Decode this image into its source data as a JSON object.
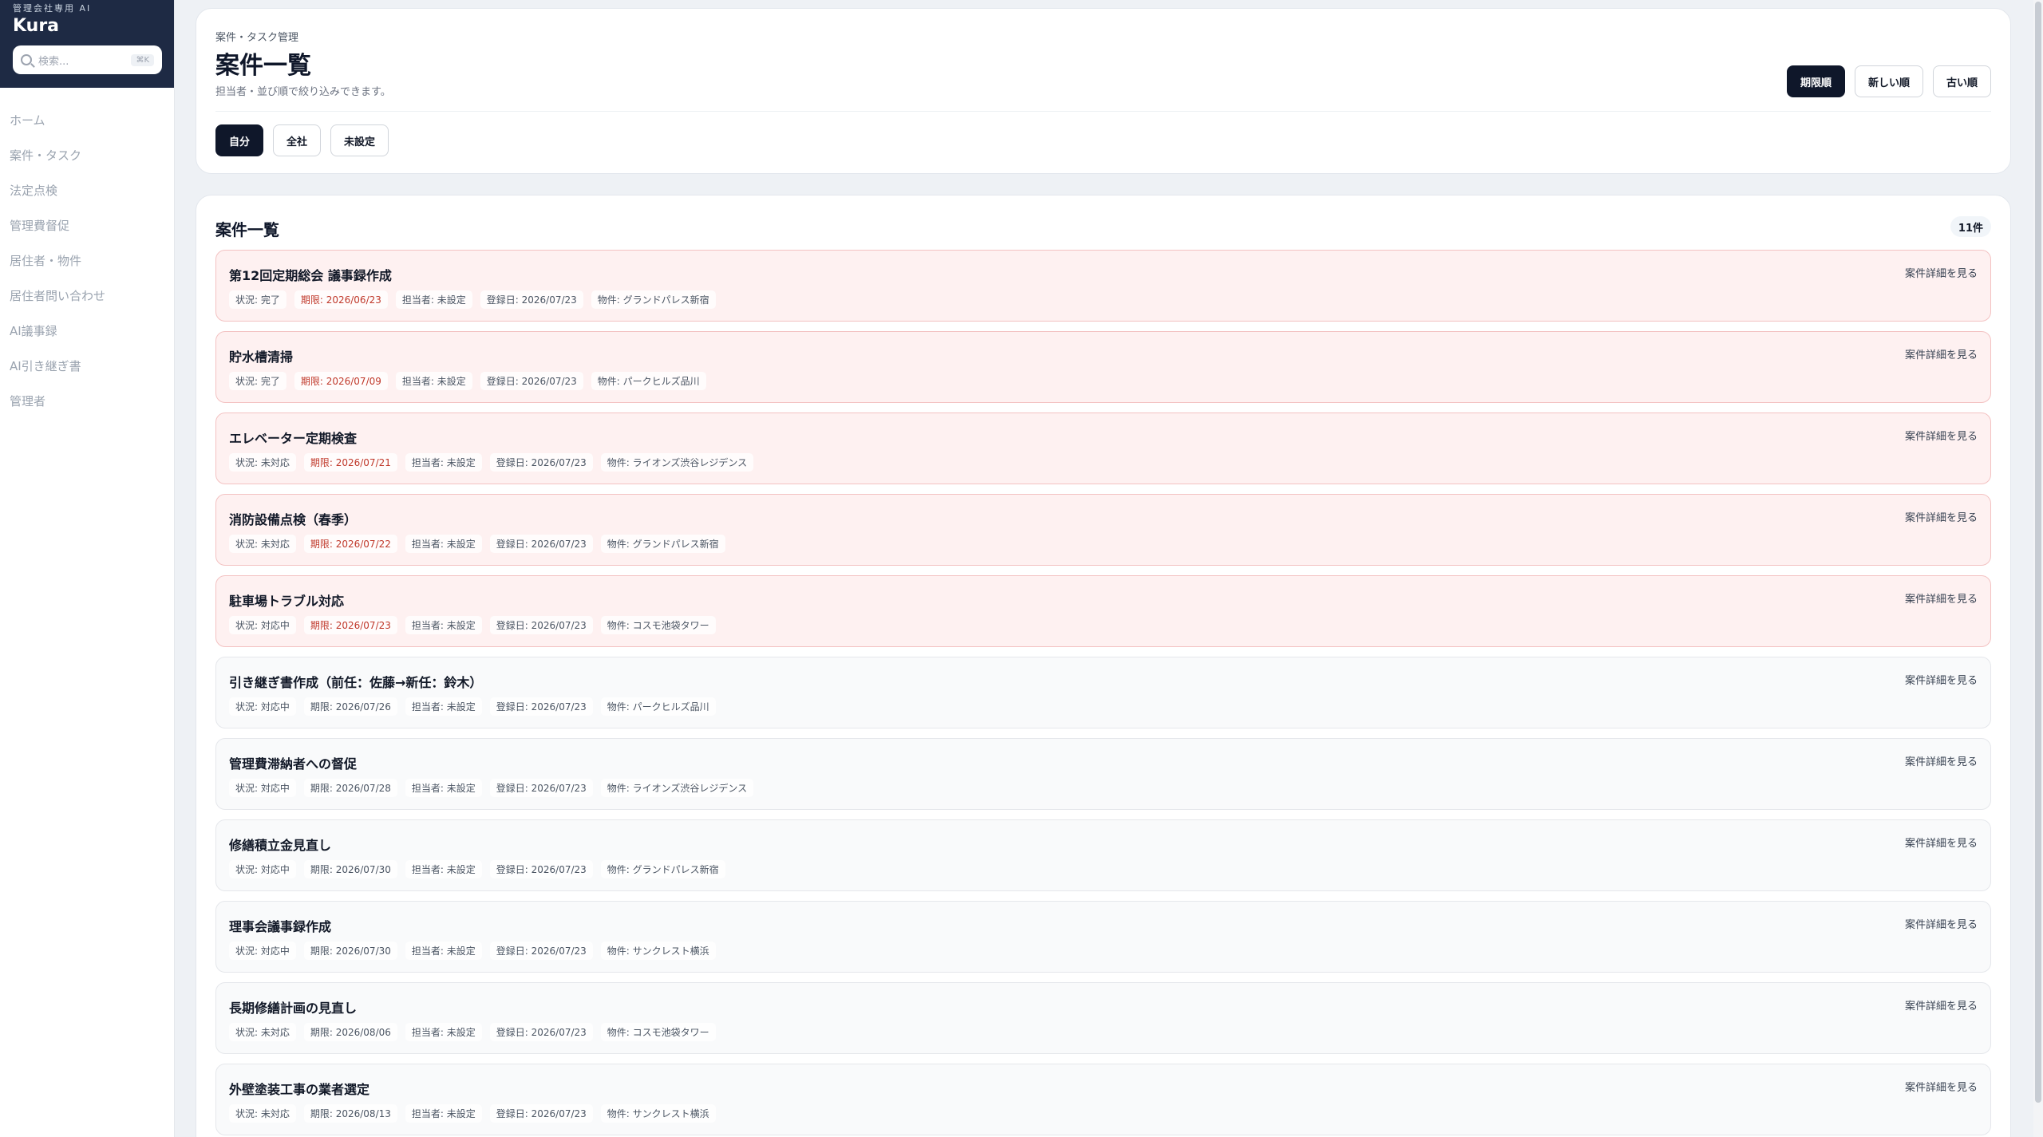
{
  "sidebar": {
    "brand_sub": "管理会社専用 AI",
    "brand_title": "Kura",
    "search_placeholder": "検索...",
    "search_shortcut": "⌘K",
    "items": [
      {
        "label": "ホーム"
      },
      {
        "label": "案件・タスク"
      },
      {
        "label": "法定点検"
      },
      {
        "label": "管理費督促"
      },
      {
        "label": "居住者・物件"
      },
      {
        "label": "居住者問い合わせ"
      },
      {
        "label": "AI議事録"
      },
      {
        "label": "AI引き継ぎ書"
      },
      {
        "label": "管理者"
      }
    ]
  },
  "header": {
    "breadcrumb": "案件・タスク管理",
    "title": "案件一覧",
    "description": "担当者・並び順で絞り込みできます。",
    "sort": [
      "期限順",
      "新しい順",
      "古い順"
    ],
    "sort_active": "期限順",
    "filters": [
      "自分",
      "全社",
      "未設定"
    ],
    "filter_active": "自分"
  },
  "list": {
    "title": "案件一覧",
    "count": "11件",
    "detail_label": "案件詳細を見る",
    "colors": {
      "overdue_bg": "#fef1f1",
      "overdue_text": "#c0392b",
      "normal_bg": "#f9fafb"
    },
    "rows": [
      {
        "title": "第12回定期総会 議事録作成",
        "status": "状況: 完了",
        "due": "期限: 2026/06/23",
        "assignee": "担当者: 未設定",
        "registered": "登録日: 2026/07/23",
        "property": "物件: グランドパレス新宿",
        "overdue": true
      },
      {
        "title": "貯水槽清掃",
        "status": "状況: 完了",
        "due": "期限: 2026/07/09",
        "assignee": "担当者: 未設定",
        "registered": "登録日: 2026/07/23",
        "property": "物件: パークヒルズ品川",
        "overdue": true
      },
      {
        "title": "エレベーター定期検査",
        "status": "状況: 未対応",
        "due": "期限: 2026/07/21",
        "assignee": "担当者: 未設定",
        "registered": "登録日: 2026/07/23",
        "property": "物件: ライオンズ渋谷レジデンス",
        "overdue": true
      },
      {
        "title": "消防設備点検（春季）",
        "status": "状況: 未対応",
        "due": "期限: 2026/07/22",
        "assignee": "担当者: 未設定",
        "registered": "登録日: 2026/07/23",
        "property": "物件: グランドパレス新宿",
        "overdue": true
      },
      {
        "title": "駐車場トラブル対応",
        "status": "状況: 対応中",
        "due": "期限: 2026/07/23",
        "assignee": "担当者: 未設定",
        "registered": "登録日: 2026/07/23",
        "property": "物件: コスモ池袋タワー",
        "overdue": true
      },
      {
        "title": "引き継ぎ書作成（前任：佐藤→新任：鈴木）",
        "status": "状況: 対応中",
        "due": "期限: 2026/07/26",
        "assignee": "担当者: 未設定",
        "registered": "登録日: 2026/07/23",
        "property": "物件: パークヒルズ品川",
        "overdue": false
      },
      {
        "title": "管理費滞納者への督促",
        "status": "状況: 対応中",
        "due": "期限: 2026/07/28",
        "assignee": "担当者: 未設定",
        "registered": "登録日: 2026/07/23",
        "property": "物件: ライオンズ渋谷レジデンス",
        "overdue": false
      },
      {
        "title": "修繕積立金見直し",
        "status": "状況: 対応中",
        "due": "期限: 2026/07/30",
        "assignee": "担当者: 未設定",
        "registered": "登録日: 2026/07/23",
        "property": "物件: グランドパレス新宿",
        "overdue": false
      },
      {
        "title": "理事会議事録作成",
        "status": "状況: 対応中",
        "due": "期限: 2026/07/30",
        "assignee": "担当者: 未設定",
        "registered": "登録日: 2026/07/23",
        "property": "物件: サンクレスト横浜",
        "overdue": false
      },
      {
        "title": "長期修繕計画の見直し",
        "status": "状況: 未対応",
        "due": "期限: 2026/08/06",
        "assignee": "担当者: 未設定",
        "registered": "登録日: 2026/07/23",
        "property": "物件: コスモ池袋タワー",
        "overdue": false
      },
      {
        "title": "外壁塗装工事の業者選定",
        "status": "状況: 未対応",
        "due": "期限: 2026/08/13",
        "assignee": "担当者: 未設定",
        "registered": "登録日: 2026/07/23",
        "property": "物件: サンクレスト横浜",
        "overdue": false
      }
    ]
  }
}
